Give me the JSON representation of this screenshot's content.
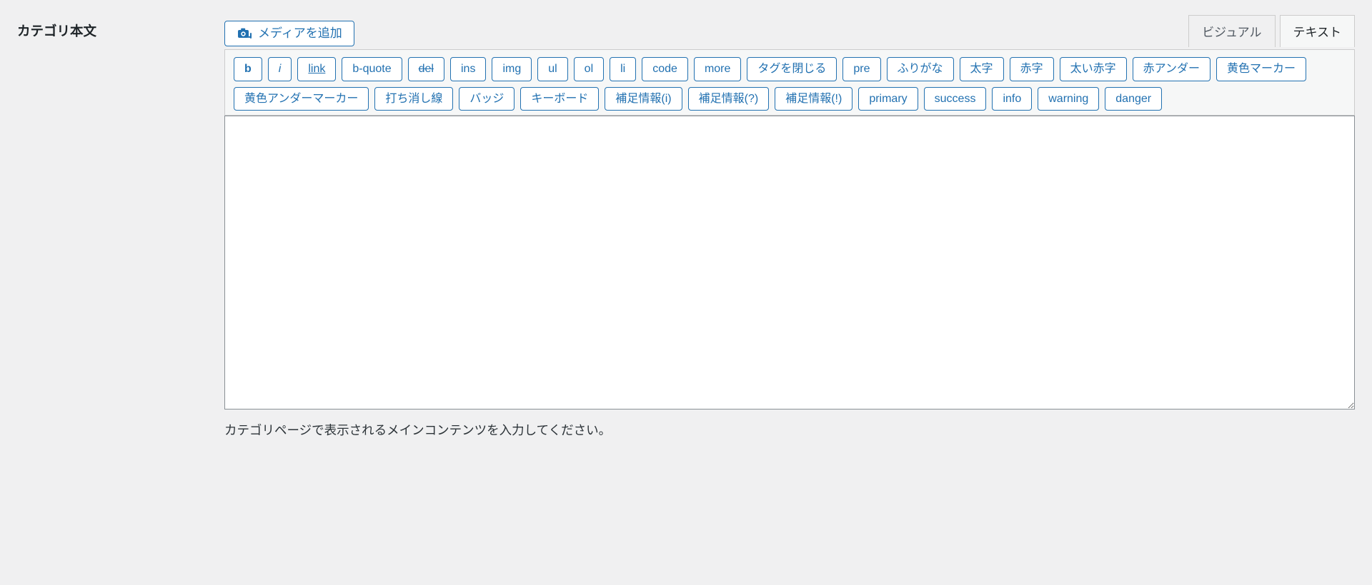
{
  "section_label": "カテゴリ本文",
  "media_button_label": "メディアを追加",
  "tabs": {
    "visual": "ビジュアル",
    "text": "テキスト",
    "active": "text"
  },
  "quicktags": [
    {
      "label": "b",
      "style": "bold",
      "name": "qt-bold"
    },
    {
      "label": "i",
      "style": "italic",
      "name": "qt-italic"
    },
    {
      "label": "link",
      "style": "underline",
      "name": "qt-link"
    },
    {
      "label": "b-quote",
      "style": "plain",
      "name": "qt-blockquote"
    },
    {
      "label": "del",
      "style": "strike",
      "name": "qt-del"
    },
    {
      "label": "ins",
      "style": "plain",
      "name": "qt-ins"
    },
    {
      "label": "img",
      "style": "plain",
      "name": "qt-img"
    },
    {
      "label": "ul",
      "style": "plain",
      "name": "qt-ul"
    },
    {
      "label": "ol",
      "style": "plain",
      "name": "qt-ol"
    },
    {
      "label": "li",
      "style": "plain",
      "name": "qt-li"
    },
    {
      "label": "code",
      "style": "plain",
      "name": "qt-code"
    },
    {
      "label": "more",
      "style": "plain",
      "name": "qt-more"
    },
    {
      "label": "タグを閉じる",
      "style": "plain",
      "name": "qt-close-tags"
    },
    {
      "label": "pre",
      "style": "plain",
      "name": "qt-pre"
    },
    {
      "label": "ふりがな",
      "style": "plain",
      "name": "qt-ruby"
    },
    {
      "label": "太字",
      "style": "plain",
      "name": "qt-futoji"
    },
    {
      "label": "赤字",
      "style": "plain",
      "name": "qt-akaji"
    },
    {
      "label": "太い赤字",
      "style": "plain",
      "name": "qt-bold-red"
    },
    {
      "label": "赤アンダー",
      "style": "plain",
      "name": "qt-red-underline"
    },
    {
      "label": "黄色マーカー",
      "style": "plain",
      "name": "qt-yellow-marker"
    },
    {
      "label": "黄色アンダーマーカー",
      "style": "plain",
      "name": "qt-yellow-under-marker"
    },
    {
      "label": "打ち消し線",
      "style": "plain",
      "name": "qt-strikethrough"
    },
    {
      "label": "バッジ",
      "style": "plain",
      "name": "qt-badge"
    },
    {
      "label": "キーボード",
      "style": "plain",
      "name": "qt-keyboard"
    },
    {
      "label": "補足情報(i)",
      "style": "plain",
      "name": "qt-note-info"
    },
    {
      "label": "補足情報(?)",
      "style": "plain",
      "name": "qt-note-question"
    },
    {
      "label": "補足情報(!)",
      "style": "plain",
      "name": "qt-note-alert"
    },
    {
      "label": "primary",
      "style": "plain",
      "name": "qt-primary"
    },
    {
      "label": "success",
      "style": "plain",
      "name": "qt-success"
    },
    {
      "label": "info",
      "style": "plain",
      "name": "qt-info"
    },
    {
      "label": "warning",
      "style": "plain",
      "name": "qt-warning"
    },
    {
      "label": "danger",
      "style": "plain",
      "name": "qt-danger"
    }
  ],
  "editor": {
    "value": "",
    "placeholder": ""
  },
  "help_text": "カテゴリページで表示されるメインコンテンツを入力してください。"
}
